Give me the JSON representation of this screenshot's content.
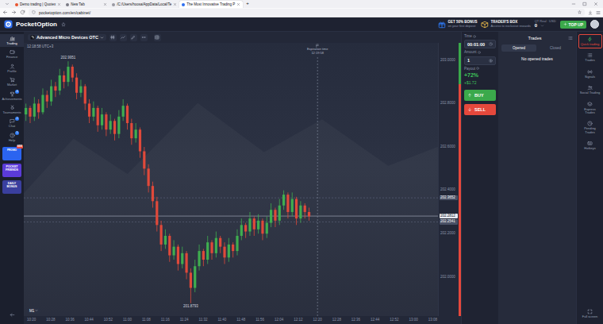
{
  "browser": {
    "tabs": [
      {
        "label": "Demo trading | Quotex",
        "selected": false
      },
      {
        "label": "New Tab",
        "selected": false
      },
      {
        "label": "/C:/Users/hoosa/AppData/Local/Te",
        "selected": false
      },
      {
        "label": "The Most Innovative Trading P",
        "selected": true
      }
    ],
    "new_tab": "+",
    "address": "pocketoption.com/en/cabinet/"
  },
  "header": {
    "logo": "PocketOption",
    "bonus": {
      "title": "GET 50% BONUS",
      "subtitle": "on your first deposit"
    },
    "traders_box": {
      "title": "TRADER'S BOX",
      "subtitle": "Access to exclusive rewards"
    },
    "account": {
      "label": "QT Real · USD",
      "balance": "0"
    },
    "top_up": "TOP UP"
  },
  "left_sidebar": {
    "items": [
      {
        "label": "Trading",
        "selected": true
      },
      {
        "label": "Finance",
        "selected": false
      },
      {
        "label": "Profile",
        "selected": false
      },
      {
        "label": "Market",
        "selected": false
      },
      {
        "label": "Achievements",
        "selected": false,
        "badge": "4"
      },
      {
        "label": "Tournaments",
        "selected": false
      },
      {
        "label": "Chat",
        "selected": false,
        "badge": "2"
      },
      {
        "label": "Help",
        "selected": false,
        "badge": "1"
      }
    ],
    "promos": [
      {
        "label": "PROMO",
        "badge": "NEW"
      },
      {
        "label": "POCKET FRIENDS"
      },
      {
        "label": "DAILY BONUS"
      }
    ]
  },
  "chart": {
    "asset": "Advanced Micro Devices OTC",
    "clock": "12:18:58 UTC+3",
    "timeframe": "M1",
    "y_ticks": [
      {
        "value": 203.0,
        "label": "203.0000"
      },
      {
        "value": 202.8,
        "label": "202.8000"
      },
      {
        "value": 202.6,
        "label": "202.6000"
      },
      {
        "value": 202.4,
        "label": "202.4000"
      },
      {
        "value": 202.2,
        "label": "202.2000"
      },
      {
        "value": 202.0,
        "label": "202.0000"
      }
    ],
    "x_ticks": [
      "10:20",
      "10:28",
      "10:36",
      "10:44",
      "10:52",
      "11:00",
      "11:08",
      "11:16",
      "11:24",
      "11:32",
      "11:40",
      "11:48",
      "11:56",
      "12:04",
      "12:12",
      "12:20",
      "12:28",
      "12:36",
      "12:44",
      "12:52",
      "13:00",
      "13:08"
    ],
    "candles": [
      [
        202.75,
        202.8,
        202.72,
        202.78
      ],
      [
        202.78,
        202.79,
        202.71,
        202.74
      ],
      [
        202.74,
        202.83,
        202.72,
        202.8
      ],
      [
        202.8,
        202.82,
        202.73,
        202.76
      ],
      [
        202.76,
        202.87,
        202.75,
        202.84
      ],
      [
        202.84,
        202.86,
        202.78,
        202.81
      ],
      [
        202.81,
        202.91,
        202.79,
        202.88
      ],
      [
        202.88,
        202.9,
        202.83,
        202.86
      ],
      [
        202.86,
        202.96,
        202.84,
        202.93
      ],
      [
        202.93,
        202.95,
        202.87,
        202.9
      ],
      [
        202.9,
        202.9951,
        202.88,
        202.97
      ],
      [
        202.97,
        202.98,
        202.9,
        202.92
      ],
      [
        202.92,
        202.94,
        202.82,
        202.85
      ],
      [
        202.85,
        202.91,
        202.83,
        202.88
      ],
      [
        202.88,
        202.89,
        202.77,
        202.8
      ],
      [
        202.8,
        202.82,
        202.71,
        202.74
      ],
      [
        202.74,
        202.81,
        202.72,
        202.78
      ],
      [
        202.78,
        202.79,
        202.67,
        202.7
      ],
      [
        202.7,
        202.78,
        202.68,
        202.75
      ],
      [
        202.75,
        202.76,
        202.65,
        202.68
      ],
      [
        202.68,
        202.75,
        202.66,
        202.72
      ],
      [
        202.72,
        202.73,
        202.63,
        202.66
      ],
      [
        202.66,
        202.77,
        202.64,
        202.74
      ],
      [
        202.74,
        202.82,
        202.72,
        202.79
      ],
      [
        202.79,
        202.8,
        202.68,
        202.71
      ],
      [
        202.71,
        202.73,
        202.61,
        202.64
      ],
      [
        202.64,
        202.71,
        202.62,
        202.68
      ],
      [
        202.68,
        202.69,
        202.55,
        202.58
      ],
      [
        202.58,
        202.6,
        202.47,
        202.5
      ],
      [
        202.5,
        202.52,
        202.39,
        202.42
      ],
      [
        202.42,
        202.44,
        202.32,
        202.35
      ],
      [
        202.35,
        202.37,
        202.21,
        202.24
      ],
      [
        202.24,
        202.26,
        202.12,
        202.15
      ],
      [
        202.15,
        202.22,
        202.13,
        202.19
      ],
      [
        202.19,
        202.2,
        202.07,
        202.1
      ],
      [
        202.1,
        202.17,
        202.08,
        202.14
      ],
      [
        202.14,
        202.15,
        202.03,
        202.06
      ],
      [
        202.06,
        202.14,
        202.04,
        202.11
      ],
      [
        202.11,
        202.12,
        201.99,
        202.02
      ],
      [
        202.02,
        202.04,
        201.8793,
        201.95
      ],
      [
        201.95,
        202.08,
        201.93,
        202.05
      ],
      [
        202.05,
        202.15,
        202.03,
        202.12
      ],
      [
        202.12,
        202.13,
        202.05,
        202.08
      ],
      [
        202.08,
        202.19,
        202.06,
        202.16
      ],
      [
        202.16,
        202.17,
        202.08,
        202.11
      ],
      [
        202.11,
        202.21,
        202.09,
        202.18
      ],
      [
        202.18,
        202.19,
        202.11,
        202.14
      ],
      [
        202.14,
        202.16,
        202.06,
        202.09
      ],
      [
        202.09,
        202.18,
        202.07,
        202.15
      ],
      [
        202.15,
        202.16,
        202.09,
        202.12
      ],
      [
        202.12,
        202.22,
        202.1,
        202.19
      ],
      [
        202.19,
        202.27,
        202.17,
        202.24
      ],
      [
        202.24,
        202.25,
        202.18,
        202.21
      ],
      [
        202.21,
        202.3,
        202.19,
        202.27
      ],
      [
        202.27,
        202.28,
        202.19,
        202.22
      ],
      [
        202.22,
        202.29,
        202.2,
        202.26
      ],
      [
        202.26,
        202.27,
        202.17,
        202.2
      ],
      [
        202.2,
        202.28,
        202.18,
        202.25
      ],
      [
        202.25,
        202.34,
        202.23,
        202.31
      ],
      [
        202.31,
        202.32,
        202.23,
        202.26
      ],
      [
        202.26,
        202.36,
        202.24,
        202.33
      ],
      [
        202.33,
        202.4,
        202.31,
        202.38
      ],
      [
        202.38,
        202.39,
        202.27,
        202.3
      ],
      [
        202.3,
        202.39,
        202.28,
        202.36
      ],
      [
        202.36,
        202.37,
        202.24,
        202.27
      ],
      [
        202.27,
        202.35,
        202.25,
        202.33
      ],
      [
        202.33,
        202.34,
        202.27,
        202.3
      ],
      [
        202.3,
        202.32,
        202.26,
        202.28
      ]
    ],
    "price_lines": [
      {
        "value": 202.3652,
        "label": "202.3652",
        "current": false
      },
      {
        "value": 202.2812,
        "label": "202.2812",
        "current": true
      },
      {
        "value": 202.2541,
        "label": "202.2541",
        "current": false
      }
    ],
    "annotations": [
      {
        "index": 10,
        "value": 202.9951,
        "label": "202.9951"
      },
      {
        "index": 39,
        "value": 201.8793,
        "label": "201.8793"
      }
    ],
    "expiration": {
      "label": "Expiration time",
      "time": "12:19:58"
    },
    "sentiment": {
      "buy_level": 0.15
    }
  },
  "trade_panel": {
    "time": {
      "label": "Time",
      "value": "00:01:00"
    },
    "amount": {
      "label": "Amount",
      "value": "1"
    },
    "payout": {
      "label": "Payout",
      "percent": "+72%",
      "profit": "+$1.72"
    },
    "buy": "BUY",
    "sell": "SELL"
  },
  "trades": {
    "title": "Trades",
    "tabs": [
      {
        "label": "Opened",
        "selected": true
      },
      {
        "label": "Closed",
        "selected": false
      }
    ],
    "empty": "No opened trades"
  },
  "right_sidebar": {
    "items": [
      {
        "label": "Quick trading",
        "selected": true
      },
      {
        "label": "Trades",
        "selected": false
      },
      {
        "label": "Signals",
        "selected": false
      },
      {
        "label": "Social Trading",
        "selected": false
      },
      {
        "label": "Express Trades",
        "selected": false
      },
      {
        "label": "Pending Trades",
        "selected": false
      },
      {
        "label": "Hotkeys",
        "selected": false
      }
    ],
    "full_screen": "Full screen"
  }
}
